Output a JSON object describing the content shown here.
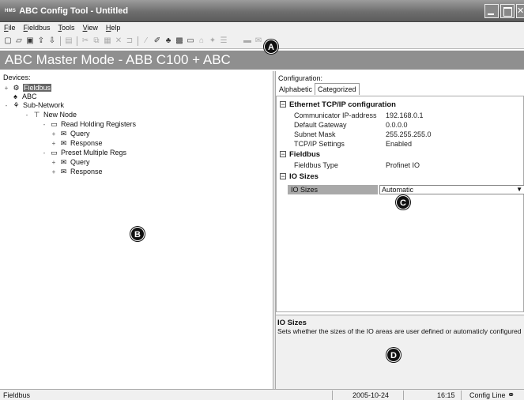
{
  "window": {
    "logo": "HMS",
    "title": "ABC Config Tool - Untitled"
  },
  "menu": {
    "items": [
      "File",
      "Fieldbus",
      "Tools",
      "View",
      "Help"
    ],
    "mnemonics": [
      "F",
      "F",
      "T",
      "V",
      "H"
    ]
  },
  "toolbar": {
    "icons": [
      "new-icon",
      "open-icon",
      "save-icon",
      "upload-icon",
      "download-icon",
      "connect-icon",
      "cut-icon",
      "copy-icon",
      "paste-icon",
      "delete-icon",
      "insert-icon",
      "wand-icon",
      "wand2-icon",
      "node-icon",
      "monitor-icon",
      "screen-icon",
      "network-icon",
      "wizard-icon",
      "options-icon",
      "folder-icon",
      "mail-icon"
    ]
  },
  "banner": {
    "text": "ABC Master Mode - ABB C100 + ABC"
  },
  "devices": {
    "label": "Devices:",
    "tree": [
      {
        "label": "Fieldbus",
        "level": 0,
        "expander": "+",
        "icon": "fieldbus-icon",
        "selected": true
      },
      {
        "label": "ABC",
        "level": 1,
        "expander": "",
        "icon": "abc-icon",
        "selected": false
      },
      {
        "label": "Sub-Network",
        "level": 0,
        "expander": "-",
        "icon": "subnetwork-icon",
        "selected": false
      },
      {
        "label": "New Node",
        "level": 1,
        "expander": "-",
        "icon": "node-icon",
        "selected": false
      },
      {
        "label": "Read Holding Registers",
        "level": 2,
        "expander": "-",
        "icon": "folder-icon",
        "selected": false
      },
      {
        "label": "Query",
        "level": 3,
        "expander": "+",
        "icon": "mail-icon",
        "selected": false
      },
      {
        "label": "Response",
        "level": 3,
        "expander": "+",
        "icon": "mail-icon",
        "selected": false
      },
      {
        "label": "Preset Multiple Regs",
        "level": 2,
        "expander": "-",
        "icon": "folder-icon",
        "selected": false
      },
      {
        "label": "Query",
        "level": 3,
        "expander": "+",
        "icon": "mail-icon",
        "selected": false
      },
      {
        "label": "Response",
        "level": 3,
        "expander": "+",
        "icon": "mail-icon",
        "selected": false
      }
    ]
  },
  "configuration": {
    "label": "Configuration:",
    "tabs": [
      "Alphabetic",
      "Categorized"
    ],
    "active_tab": "Categorized",
    "categories": [
      {
        "name": "Ethernet TCP/IP configuration",
        "properties": [
          {
            "name": "Communicator IP-address",
            "value": "192.168.0.1"
          },
          {
            "name": "Default Gateway",
            "value": "0.0.0.0"
          },
          {
            "name": "Subnet Mask",
            "value": "255.255.255.0"
          },
          {
            "name": "TCP/IP Settings",
            "value": "Enabled"
          }
        ]
      },
      {
        "name": "Fieldbus",
        "properties": [
          {
            "name": "Fieldbus Type",
            "value": "Profinet IO"
          }
        ]
      },
      {
        "name": "IO Sizes",
        "properties": [
          {
            "name": "IO Sizes",
            "value": "Automatic"
          }
        ]
      }
    ]
  },
  "description": {
    "title": "IO Sizes",
    "text": "Sets whether the sizes of the IO areas are user defined or automaticly configured"
  },
  "status": {
    "left": "Fieldbus",
    "date": "2005-10-24",
    "time": "16:15",
    "mode": "Config Line"
  },
  "markers": [
    "A",
    "B",
    "C",
    "D"
  ]
}
